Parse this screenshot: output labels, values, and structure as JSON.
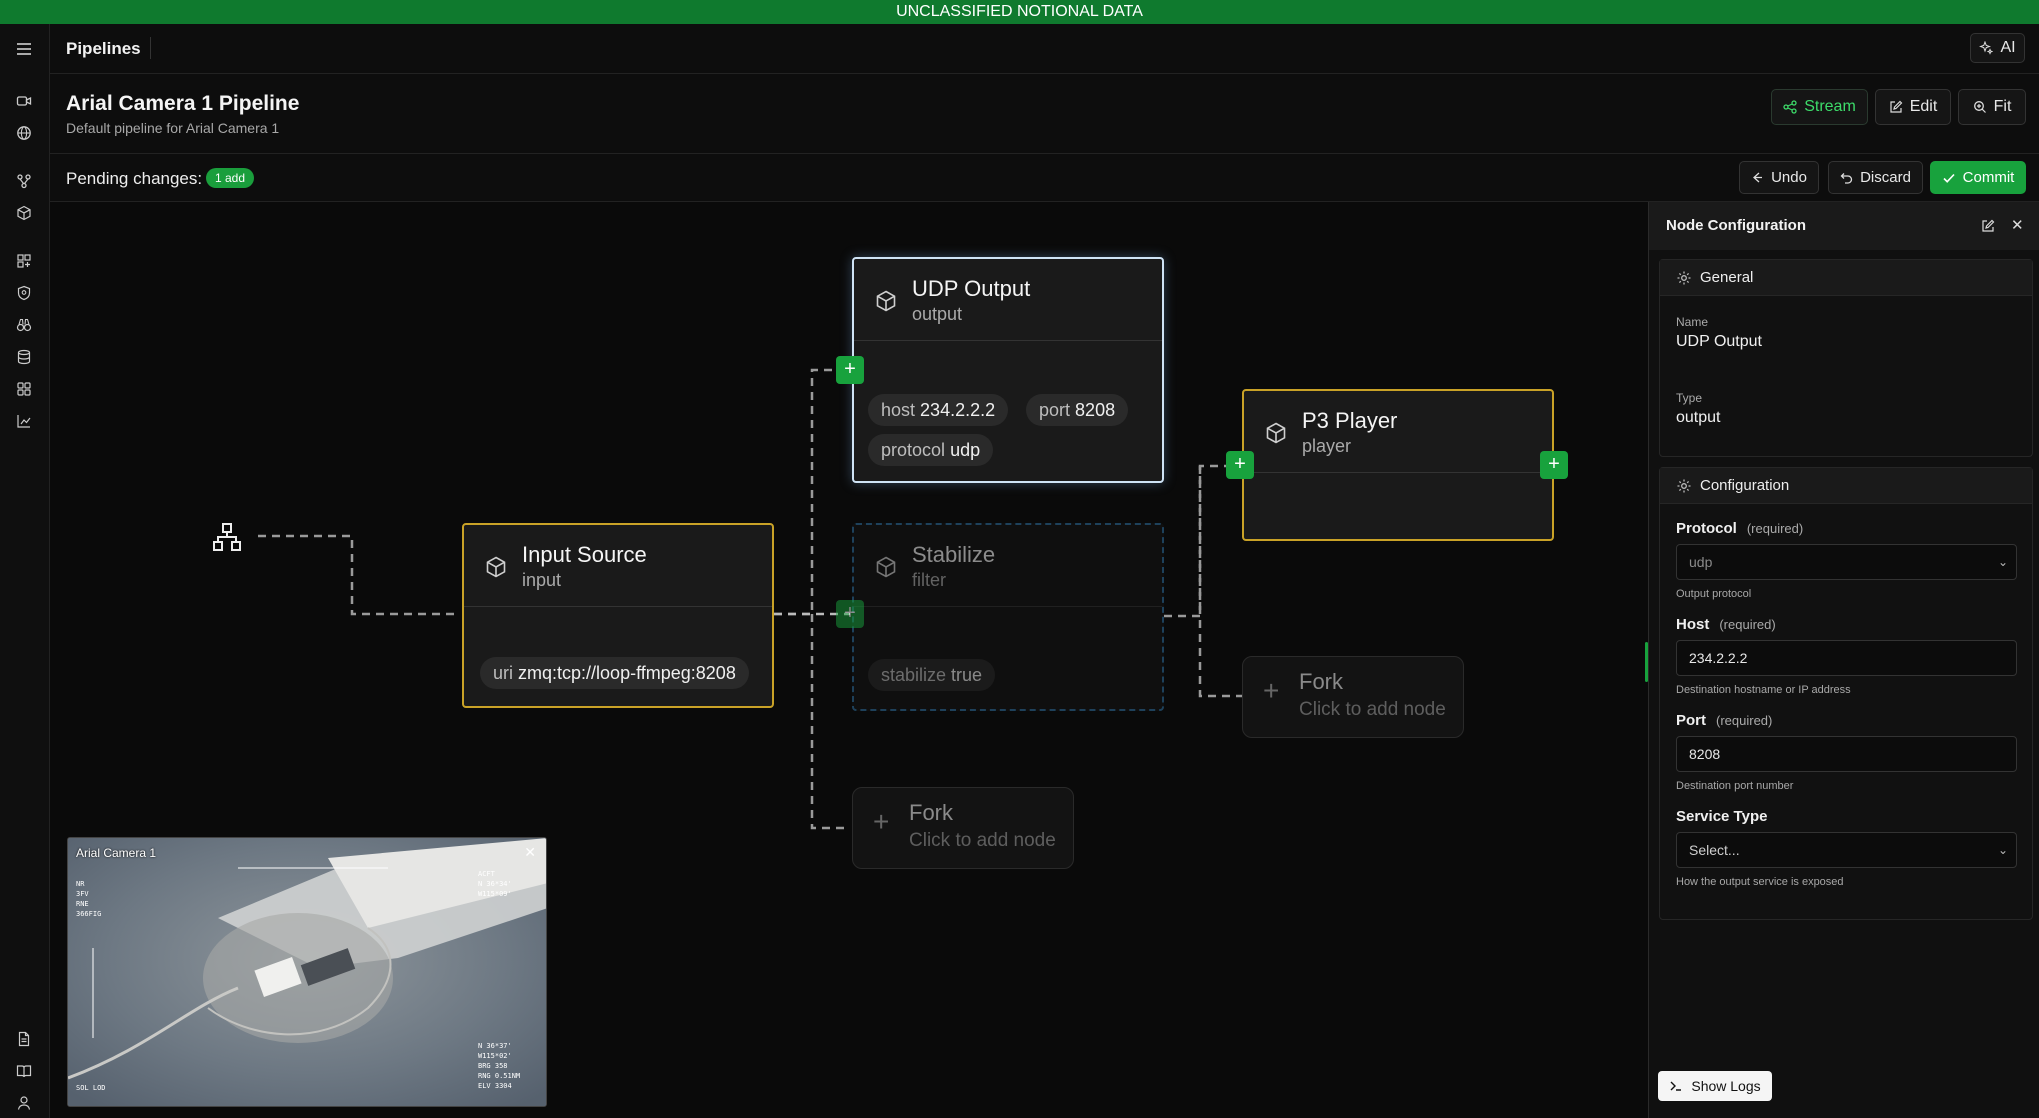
{
  "banner": "UNCLASSIFIED NOTIONAL DATA",
  "topbar": {
    "title": "Pipelines",
    "ai_label": "AI"
  },
  "pipeline": {
    "title": "Arial Camera 1 Pipeline",
    "subtitle": "Default pipeline for Arial Camera 1",
    "actions": {
      "stream": "Stream",
      "edit": "Edit",
      "fit": "Fit"
    }
  },
  "pending": {
    "label": "Pending changes:",
    "badge": "1 add",
    "undo": "Undo",
    "discard": "Discard",
    "commit": "Commit"
  },
  "nodes": {
    "input": {
      "title": "Input Source",
      "type": "input",
      "props": [
        {
          "key": "uri",
          "value": "zmq:tcp://loop-ffmpeg:8208"
        }
      ]
    },
    "udp": {
      "title": "UDP Output",
      "type": "output",
      "props": [
        {
          "key": "host",
          "value": "234.2.2.2"
        },
        {
          "key": "port",
          "value": "8208"
        },
        {
          "key": "protocol",
          "value": "udp"
        }
      ]
    },
    "stabilize": {
      "title": "Stabilize",
      "type": "filter",
      "props": [
        {
          "key": "stabilize",
          "value": "true"
        }
      ]
    },
    "player": {
      "title": "P3 Player",
      "type": "player"
    },
    "fork1": {
      "title": "Fork",
      "subtitle": "Click to add node"
    },
    "fork2": {
      "title": "Fork",
      "subtitle": "Click to add node"
    }
  },
  "video": {
    "title": "Arial Camera 1"
  },
  "panel": {
    "title": "Node Configuration",
    "general": {
      "heading": "General",
      "name_label": "Name",
      "name_value": "UDP Output",
      "type_label": "Type",
      "type_value": "output"
    },
    "config": {
      "heading": "Configuration",
      "protocol": {
        "label": "Protocol",
        "req": "(required)",
        "value": "udp",
        "help": "Output protocol"
      },
      "host": {
        "label": "Host",
        "req": "(required)",
        "value": "234.2.2.2",
        "help": "Destination hostname or IP address"
      },
      "port": {
        "label": "Port",
        "req": "(required)",
        "value": "8208",
        "help": "Destination port number"
      },
      "service": {
        "label": "Service Type",
        "placeholder": "Select...",
        "help": "How the output service is exposed"
      }
    }
  },
  "logs": {
    "label": "Show Logs"
  },
  "colors": {
    "banner": "#0f7a2e",
    "accent_green": "#18a23d",
    "selected_border": "#c9a227",
    "active_border": "#cfe3f5",
    "draft_border": "#2f6f9e"
  }
}
